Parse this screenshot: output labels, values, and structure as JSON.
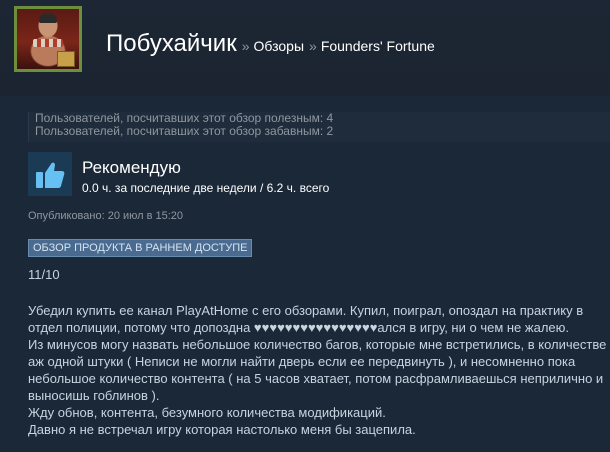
{
  "header": {
    "user_name": "Побухайчик",
    "separator": "»",
    "crumb_reviews": "Обзоры",
    "crumb_game": "Founders' Fortune"
  },
  "helpful": {
    "useful_line": "Пользователей, посчитавших этот обзор полезным: 4",
    "funny_line": "Пользователей, посчитавших этот обзор забавным: 2"
  },
  "recommendation": {
    "icon": "thumbs-up-icon",
    "title": "Рекомендую",
    "hours": "0.0 ч. за последние две недели / 6.2 ч. всего"
  },
  "published": "Опубликовано: 20 июл в 15:20",
  "early_access_badge": "ОБЗОР ПРОДУКТА В РАННЕМ ДОСТУПЕ",
  "score": "11/10",
  "review_lines": [
    "Убедил купить ее канал PlayAtHome с его обзорами. Купил, поиграл, опоздал на практику в",
    "отдел полиции, потому что допоздна ♥♥♥♥♥♥♥♥♥♥♥♥♥♥♥♥ался в игру, ни о чем не жалею.",
    "Из минусов могу назвать небольшое количество багов, которые мне встретились, в количестве",
    "аж одной штуки ( Неписи не могли найти дверь если ее передвинуть ), и несомненно пока",
    "небольшое количество контента ( на 5 часов хватает, потом расфрамливаешься неприлично и",
    "выносишь гоблинов ).",
    "Жду обнов, контента, безумного количества модификаций.",
    "Давно я не встречал игру которая настолько меня бы зацепила."
  ],
  "colors": {
    "background": "#1b2838",
    "link": "#ffffff",
    "muted": "#8f98a0",
    "badge": "#4a6b8f",
    "thumb": "#66c0f4"
  }
}
